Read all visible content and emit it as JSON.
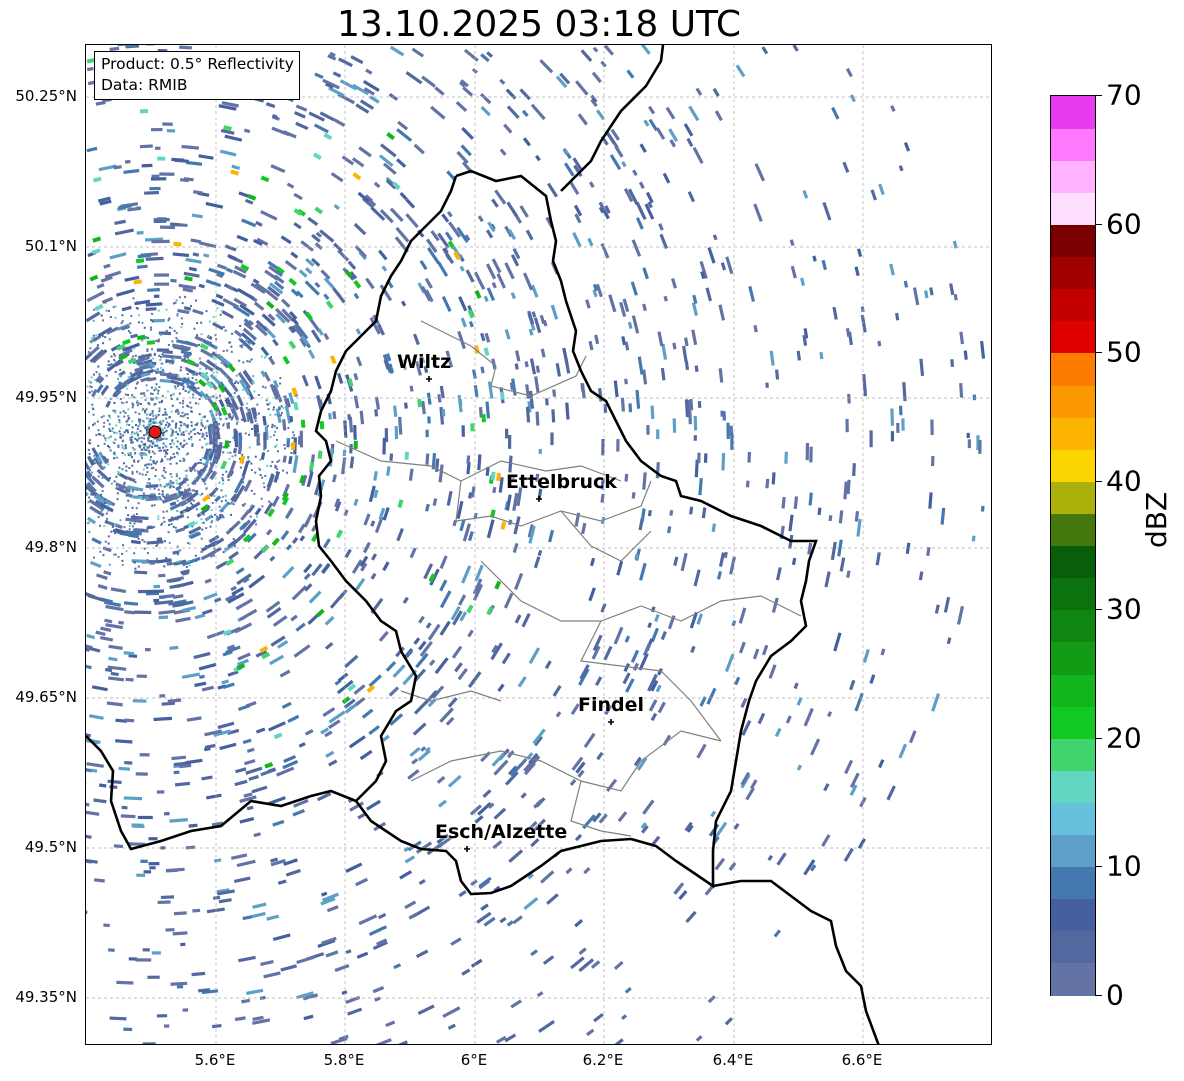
{
  "title": "13.10.2025 03:18 UTC",
  "info_box": {
    "line1": "Product: 0.5° Reflectivity",
    "line2": "Data: RMIB"
  },
  "lat_labels": [
    "50.25°N",
    "50.1°N",
    "49.95°N",
    "49.8°N",
    "49.65°N",
    "49.5°N",
    "49.35°N"
  ],
  "lon_labels": [
    "5.6°E",
    "5.8°E",
    "6°E",
    "6.2°E",
    "6.4°E",
    "6.6°E"
  ],
  "cities": [
    {
      "name": "Wiltz"
    },
    {
      "name": "Ettelbruck"
    },
    {
      "name": "Findel"
    },
    {
      "name": "Esch/Alzette"
    }
  ],
  "colorbar": {
    "unit": "dBZ",
    "min": 0,
    "max": 70,
    "tick_labels": [
      "0",
      "10",
      "20",
      "30",
      "40",
      "50",
      "60",
      "70"
    ],
    "colors": [
      "#6473a5",
      "#5468a0",
      "#44609f",
      "#4479b0",
      "#5ca0c8",
      "#66c2dc",
      "#62d6c2",
      "#40d46f",
      "#12c924",
      "#12b51b",
      "#129c15",
      "#0f8610",
      "#0c720e",
      "#095e09",
      "#44770c",
      "#acb00a",
      "#fcd500",
      "#fcb400",
      "#fc9800",
      "#fc7b00",
      "#e10000",
      "#c30000",
      "#a00000",
      "#7a0000",
      "#ffdfff",
      "#ffb2ff",
      "#ff78ff",
      "#e83bf0"
    ]
  },
  "colors": {
    "radar_marker": "#e31a1c",
    "border": "#000000",
    "canton_lines": "#808080",
    "grid": "#bbbbbb"
  }
}
